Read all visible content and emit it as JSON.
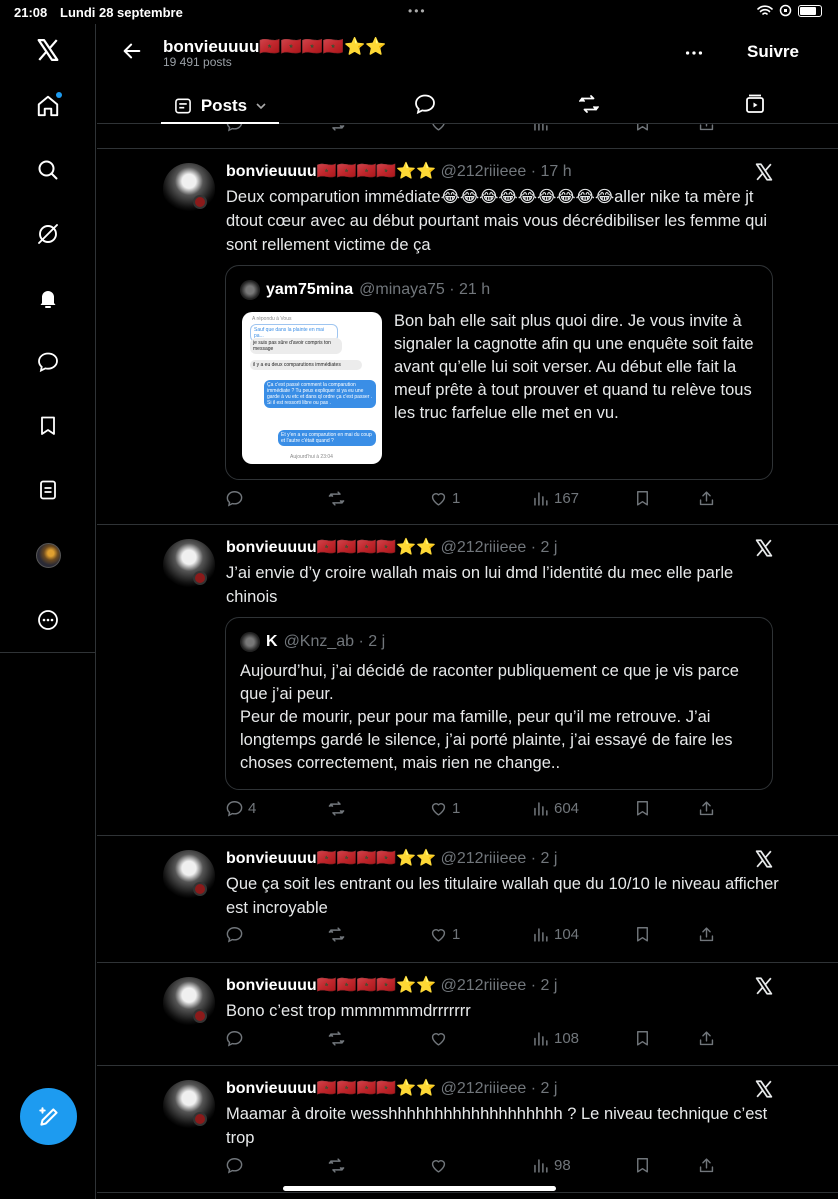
{
  "status_bar": {
    "time": "21:08",
    "date": "Lundi 28 septembre"
  },
  "sidebar": {
    "items": [
      {
        "name": "x-logo",
        "icon": "x-logo-icon"
      },
      {
        "name": "home",
        "icon": "home-icon",
        "notification_dot": true
      },
      {
        "name": "explore",
        "icon": "search-icon"
      },
      {
        "name": "grok",
        "icon": "grok-icon"
      },
      {
        "name": "notifications",
        "icon": "bell-icon"
      },
      {
        "name": "messages",
        "icon": "message-icon"
      },
      {
        "name": "bookmarks",
        "icon": "bookmark-icon"
      },
      {
        "name": "lists",
        "icon": "list-icon"
      },
      {
        "name": "profile",
        "icon": "avatar"
      },
      {
        "name": "more",
        "icon": "more-circle-icon"
      }
    ],
    "compose_icon": "compose-icon"
  },
  "header": {
    "title": "bonvieuuuu🇲🇦🇲🇦🇲🇦🇲🇦⭐⭐",
    "subtitle": "19 491 posts",
    "follow_label": "Suivre",
    "tab_posts": "Posts"
  },
  "colors": {
    "accent": "#1d9bf0",
    "background": "#000000",
    "border": "#2f3336",
    "muted": "#71767b"
  },
  "tweets": [
    {
      "name": "bonvieuuuu🇲🇦🇲🇦🇲🇦🇲🇦⭐⭐",
      "meta": "@212riiieee · 17 h",
      "text": "Deux comparution immédiate😂😂😂😂😂😂😂😂😂aller nike ta mère jt dtout cœur avec au début pourtant mais vous décrédibiliser les femme qui sont rellement victime de ça",
      "quote": {
        "name": "yam75mina",
        "meta": "@minaya75 · 21 h",
        "text": "Bon bah elle sait plus quoi dire. Je vous invite à signaler la cagnotte afin qu une enquête soit faite avant qu’elle lui soit verser. Au début elle fait la meuf prête à tout prouver et quand tu relève tous les truc farfelue elle met en vu.",
        "image": {
          "replied_to": "A répondu à Vous",
          "b1": "Sauf que dans la plainte en mai pa...",
          "b2": "je suis pas sûre d'avoir compris ton message",
          "b3": "il y a eu deux comparutions immédiates",
          "b4": "Ça c'est passé comment la comparution immédiate ? Tu peux expliquer si ya eu une garde à vu etc et dans ql ordre ça c'est passer . Si il est ressorti libre ou pas .",
          "b5": "Et y'en a eu comparution en mai du coup et l'autre c'était quand ?",
          "footer": "Aujourd'hui à 23:04"
        }
      },
      "stats": {
        "replies": "",
        "reposts": "",
        "likes": "1",
        "views": "167"
      }
    },
    {
      "name": "bonvieuuuu🇲🇦🇲🇦🇲🇦🇲🇦⭐⭐",
      "meta": "@212riiieee · 2 j",
      "text": "J’ai envie d’y croire wallah mais on lui dmd l’identité du mec elle parle chinois",
      "quote": {
        "name": "K",
        "meta": "@Knz_ab · 2 j",
        "text1": "Aujourd’hui, j’ai décidé de raconter publiquement ce que je vis parce que j’ai peur.",
        "text2": "Peur de mourir, peur pour ma famille, peur qu’il me retrouve. J’ai longtemps gardé le silence, j’ai porté plainte, j’ai essayé de faire les choses correctement, mais rien ne change.."
      },
      "stats": {
        "replies": "4",
        "reposts": "",
        "likes": "1",
        "views": "604"
      }
    },
    {
      "name": "bonvieuuuu🇲🇦🇲🇦🇲🇦🇲🇦⭐⭐",
      "meta": "@212riiieee · 2 j",
      "text": "Que ça soit les entrant ou les titulaire wallah que du 10/10 le niveau afficher est incroyable",
      "stats": {
        "replies": "",
        "reposts": "",
        "likes": "1",
        "views": "104"
      }
    },
    {
      "name": "bonvieuuuu🇲🇦🇲🇦🇲🇦🇲🇦⭐⭐",
      "meta": "@212riiieee · 2 j",
      "text": "Bono c’est trop mmmmmmdrrrrrrr",
      "stats": {
        "replies": "",
        "reposts": "",
        "likes": "",
        "views": "108"
      }
    },
    {
      "name": "bonvieuuuu🇲🇦🇲🇦🇲🇦🇲🇦⭐⭐",
      "meta": "@212riiieee · 2 j",
      "text": "Maamar à droite wesshhhhhhhhhhhhhhhhhhh ? Le niveau technique c’est trop",
      "stats": {
        "replies": "",
        "reposts": "",
        "likes": "",
        "views": "98"
      }
    }
  ]
}
